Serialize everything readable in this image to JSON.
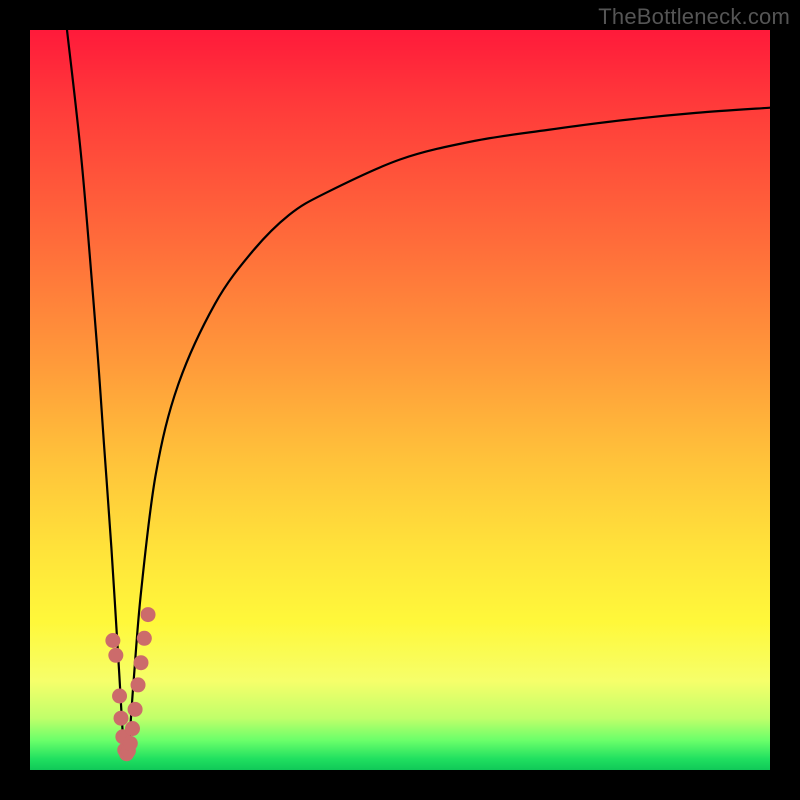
{
  "watermark_text": "TheBottleneck.com",
  "colors": {
    "frame_bg": "#000000",
    "curve_stroke": "#000000",
    "dot_fill": "#cc6b6b",
    "gradient_stops": [
      "#ff1a3a",
      "#ff3a3a",
      "#ff6a3a",
      "#ff9a3a",
      "#ffc23a",
      "#ffe23a",
      "#fff83a",
      "#f6ff6a",
      "#c0ff6a",
      "#6aff6a",
      "#20e060",
      "#10c858"
    ]
  },
  "chart_data": {
    "type": "line",
    "title": "",
    "xlabel": "",
    "ylabel": "",
    "xlim": [
      0,
      100
    ],
    "ylim": [
      0,
      100
    ],
    "notes": "V-shaped bottleneck curve. Minimum (optimal) near x≈13. Left branch descends steeply from top-left; right branch rises asymptotically toward ~90% at x=100.",
    "series": [
      {
        "name": "bottleneck-curve",
        "x": [
          5,
          7,
          9,
          10,
          11,
          12,
          12.7,
          13.3,
          14,
          15,
          17,
          20,
          25,
          30,
          35,
          40,
          50,
          60,
          70,
          80,
          90,
          100
        ],
        "y": [
          100,
          82,
          58,
          44,
          30,
          14,
          3,
          3,
          12,
          24,
          40,
          52,
          63,
          70,
          75,
          78,
          82.5,
          85,
          86.5,
          87.8,
          88.8,
          89.5
        ]
      }
    ],
    "dots": {
      "name": "highlight-dots",
      "description": "Pinkish dots clustered near the curve minimum on the green band.",
      "points_xy": [
        [
          11.2,
          17.5
        ],
        [
          11.6,
          15.5
        ],
        [
          12.1,
          10.0
        ],
        [
          12.3,
          7.0
        ],
        [
          12.55,
          4.5
        ],
        [
          12.8,
          2.7
        ],
        [
          13.05,
          2.2
        ],
        [
          13.3,
          2.6
        ],
        [
          13.55,
          3.6
        ],
        [
          13.85,
          5.6
        ],
        [
          14.2,
          8.2
        ],
        [
          14.6,
          11.5
        ],
        [
          15.0,
          14.5
        ],
        [
          15.45,
          17.8
        ],
        [
          15.95,
          21.0
        ]
      ]
    }
  }
}
